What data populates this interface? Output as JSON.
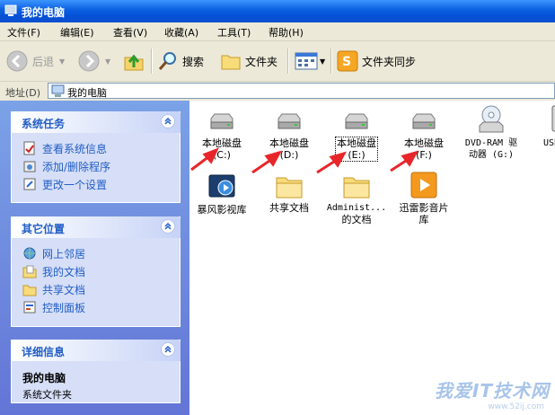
{
  "window": {
    "title": "我的电脑"
  },
  "menu": [
    "文件(F)",
    "编辑(E)",
    "查看(V)",
    "收藏(A)",
    "工具(T)",
    "帮助(H)"
  ],
  "toolbar": {
    "back": "后退",
    "search": "搜索",
    "folders": "文件夹",
    "sync": "文件夹同步"
  },
  "address": {
    "label": "地址(D)",
    "value": "我的电脑"
  },
  "panels": {
    "system": {
      "title": "系统任务",
      "items": [
        "查看系统信息",
        "添加/删除程序",
        "更改一个设置"
      ]
    },
    "other": {
      "title": "其它位置",
      "items": [
        "网上邻居",
        "我的文档",
        "共享文档",
        "控制面板"
      ]
    },
    "details": {
      "title": "详细信息",
      "name": "我的电脑",
      "desc": "系统文件夹"
    }
  },
  "items": [
    {
      "line1": "本地磁盘",
      "line2": "(C:)",
      "icon": "hard-drive-icon"
    },
    {
      "line1": "本地磁盘",
      "line2": "(D:)",
      "icon": "hard-drive-icon"
    },
    {
      "line1": "本地磁盘",
      "line2": "(E:)",
      "icon": "hard-drive-icon"
    },
    {
      "line1": "本地磁盘",
      "line2": "(F:)",
      "icon": "hard-drive-icon"
    },
    {
      "line1": "DVD-RAM 驱",
      "line2": "动器 (G:)",
      "icon": "dvd-drive-icon"
    },
    {
      "line1": "USB 驱",
      "line2": "",
      "icon": "usb-drive-icon"
    },
    {
      "line1": "暴风影视库",
      "line2": "",
      "icon": "media-library-icon"
    },
    {
      "line1": "共享文档",
      "line2": "",
      "icon": "folder-icon"
    },
    {
      "line1": "Administ...",
      "line2": "的文档",
      "icon": "folder-icon"
    },
    {
      "line1": "迅雷影音片",
      "line2": "库",
      "icon": "video-library-icon"
    }
  ],
  "watermark": {
    "main": "我爱IT技术网",
    "url": "www.52ij.com"
  },
  "colors": {
    "title_bar": "#0a5fe0",
    "task_pane": "#7ba2e7",
    "link": "#215dc6",
    "arrow": "#e8262a"
  }
}
